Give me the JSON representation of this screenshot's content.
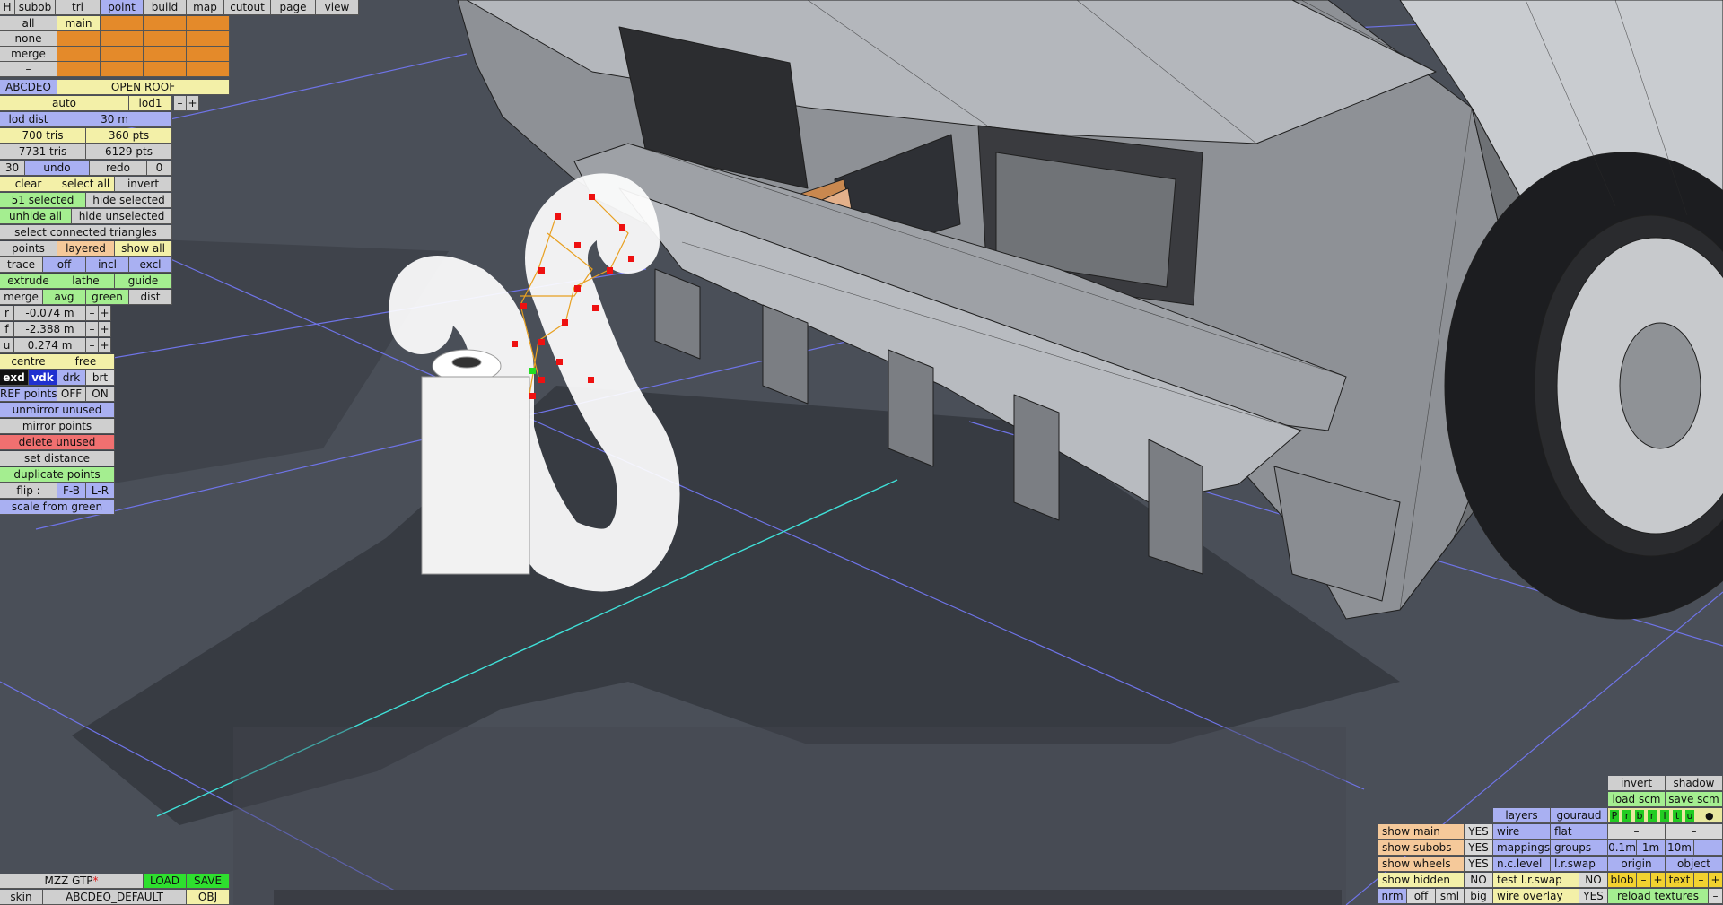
{
  "colors": {
    "background": "#4a4f58",
    "panel_blue": "#a9b0f2",
    "panel_yellow": "#f3f0a8",
    "panel_orange": "#e48a2a",
    "panel_green": "#a4ee90",
    "panel_red": "#f07070",
    "grid_line": "#6f74e8",
    "axis_line": "#3fe0d8"
  },
  "menu": [
    "subob",
    "tri",
    "point",
    "build",
    "map",
    "cutout",
    "page",
    "view"
  ],
  "menu_icon": "H",
  "layer_panel": {
    "all": "all",
    "none": "none",
    "merge": "merge",
    "dash": "–",
    "main": "main"
  },
  "model": {
    "name": "ABCDEO",
    "roof": "OPEN ROOF",
    "auto": "auto",
    "lod": "lod1",
    "minus": "–",
    "plus": "+"
  },
  "stats": {
    "lod_dist_label": "lod dist",
    "lod_dist": "30 m",
    "sel_tris": "700 tris",
    "sel_pts": "360 pts",
    "tot_tris": "7731 tris",
    "tot_pts": "6129 pts"
  },
  "undo": {
    "count": "30",
    "undo": "undo",
    "redo": "redo",
    "redo_count": "0"
  },
  "selection": {
    "clear": "clear",
    "select_all": "select all",
    "invert": "invert",
    "selected": "51 selected",
    "hide_selected": "hide selected",
    "unhide_all": "unhide all",
    "hide_unselected": "hide unselected",
    "connected": "select connected triangles"
  },
  "points_row": {
    "points": "points",
    "layered": "layered",
    "show_all": "show all"
  },
  "trace_row": {
    "trace": "trace",
    "off": "off",
    "incl": "incl",
    "excl": "excl"
  },
  "build_row": {
    "extrude": "extrude",
    "lathe": "lathe",
    "guide": "guide"
  },
  "merge_row": {
    "merge": "merge",
    "avg": "avg",
    "green": "green",
    "dist": "dist"
  },
  "coords": [
    {
      "axis": "r",
      "value": "-0.074 m"
    },
    {
      "axis": "f",
      "value": "-2.388 m"
    },
    {
      "axis": "u",
      "value": "0.274 m"
    }
  ],
  "pivot": {
    "centre": "centre",
    "free": "free"
  },
  "display_row": {
    "exd": "exd",
    "vdk": "vdk",
    "drk": "drk",
    "brt": "brt"
  },
  "ref_row": {
    "label": "REF points",
    "off": "OFF",
    "on": "ON"
  },
  "actions": {
    "unmirror": "unmirror unused",
    "mirror": "mirror points",
    "delete": "delete unused",
    "set_distance": "set distance",
    "duplicate": "duplicate points",
    "flip": "flip :",
    "fb": "F-B",
    "lr": "L-R",
    "scale": "scale from green"
  },
  "bottom_left": {
    "name": "MZZ GTP",
    "star": "*",
    "load": "LOAD",
    "save": "SAVE",
    "skin": "skin",
    "skin_name": "ABCDEO_DEFAULT",
    "obj": "OBJ"
  },
  "bottom_right": {
    "invert": "invert",
    "shadow": "shadow",
    "load_scm": "load scm",
    "save_scm": "save scm",
    "layers": "layers",
    "gouraud": "gouraud",
    "letters": [
      "P",
      "r",
      "b",
      "r",
      "l",
      "t",
      "u"
    ],
    "dot": "●",
    "dash": "–",
    "show_main": "show main",
    "show_subobs": "show subobs",
    "show_wheels": "show wheels",
    "show_hidden": "show hidden",
    "yes": "YES",
    "no": "NO",
    "wire": "wire",
    "flat": "flat",
    "mappings": "mappings",
    "groups": "groups",
    "ncl": "n.c.level",
    "lrswap": "l.r.swap",
    "test_lrswap": "test l.r.swap",
    "wire_overlay": "wire overlay",
    "m01": "0.1m",
    "m1": "1m",
    "m10": "10m",
    "origin": "origin",
    "object": "object",
    "blob": "blob",
    "text": "text",
    "minus": "–",
    "plus": "+",
    "nrm": "nrm",
    "off": "off",
    "sml": "sml",
    "big": "big",
    "reload": "reload textures"
  }
}
